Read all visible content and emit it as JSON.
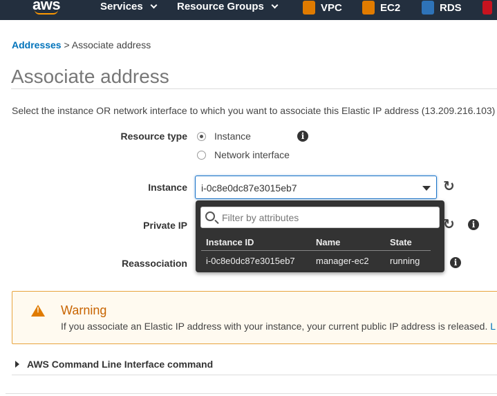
{
  "nav": {
    "logo": "aws",
    "services_label": "Services",
    "resource_groups_label": "Resource Groups",
    "shortcuts": [
      {
        "label": "VPC",
        "icon": "vpc-icon",
        "color": "#e07b00"
      },
      {
        "label": "EC2",
        "icon": "ec2-icon",
        "color": "#e07b00"
      },
      {
        "label": "RDS",
        "icon": "rds-icon",
        "color": "#2e73b8"
      }
    ]
  },
  "breadcrumb": {
    "parent": "Addresses",
    "separator": ">",
    "current": "Associate address"
  },
  "page": {
    "title": "Associate address",
    "intro": "Select the instance OR network interface to which you want to associate this Elastic IP address (13.209.216.103)"
  },
  "form": {
    "resource_type_label": "Resource type",
    "option_instance": "Instance",
    "option_network_interface": "Network interface",
    "selected_option": "Instance",
    "instance_label": "Instance",
    "instance_value": "i-0c8e0dc87e3015eb7",
    "private_ip_label": "Private IP",
    "reassociation_label": "Reassociation"
  },
  "dropdown": {
    "filter_placeholder": "Filter by attributes",
    "columns": [
      "Instance ID",
      "Name",
      "State"
    ],
    "rows": [
      {
        "instance_id": "i-0c8e0dc87e3015eb7",
        "name": "manager-ec2",
        "state": "running"
      }
    ]
  },
  "warning": {
    "title": "Warning",
    "text": "If you associate an Elastic IP address with your instance, your current public IP address is released.",
    "link_fragment": "L"
  },
  "cli": {
    "label": "AWS Command Line Interface command"
  },
  "colors": {
    "nav_bg": "#232f3e",
    "link": "#0073bb",
    "warning_border": "#e8a33c",
    "warning_title": "#c86400"
  }
}
